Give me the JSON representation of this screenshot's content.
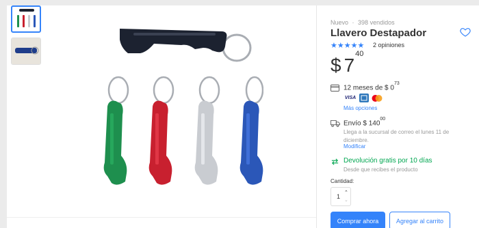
{
  "product": {
    "condition": "Nuevo",
    "separator": "·",
    "sold": "398 vendidos",
    "title": "Llavero Destapador",
    "stars": "★★★★★",
    "reviews": "2 opiniones",
    "rating": 5,
    "price_currency": "$",
    "price_int": "7",
    "price_cents": "40"
  },
  "payment": {
    "installments_text": "12 meses de $ 0",
    "installments_cents": "73",
    "card_brands": [
      "VISA",
      "amex",
      "mastercard"
    ],
    "more_options": "Más opciones"
  },
  "shipping": {
    "label": "Envío $ 140",
    "cents": "00",
    "detail": "Llega a la sucursal de correo el lunes 11 de diciembre.",
    "modify": "Modificar"
  },
  "returns": {
    "label": "Devolución gratis por 10 días",
    "detail": "Desde que recibes el producto"
  },
  "quantity": {
    "label": "Cantidad:",
    "value": "1"
  },
  "actions": {
    "buy_now": "Comprar ahora",
    "add_to_cart": "Agregar al carrito"
  },
  "colors": {
    "accent": "#3483fa",
    "green": "#00a650",
    "keychain_colors": [
      "#1e8f4e",
      "#c8202f",
      "#c9ccd1",
      "#2b57b8",
      "#1c2230"
    ]
  }
}
